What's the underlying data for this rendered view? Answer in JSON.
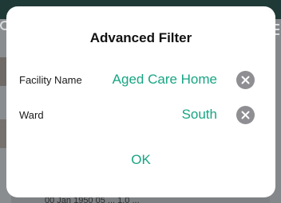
{
  "dialog": {
    "title": "Advanced Filter",
    "ok_label": "OK",
    "filters": [
      {
        "label": "Facility Name",
        "value": "Aged Care Home"
      },
      {
        "label": "Ward",
        "value": "South"
      }
    ]
  },
  "background": {
    "bottom_text": "00 Jan 1950 05 ... 1.0 ..."
  },
  "colors": {
    "accent": "#17a583",
    "clear_button": "#8e8e93"
  }
}
